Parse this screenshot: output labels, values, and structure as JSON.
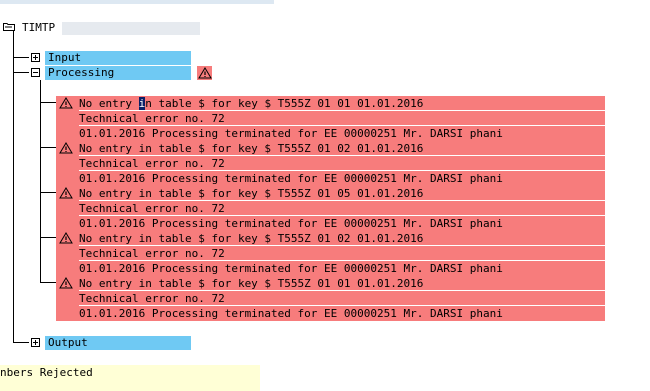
{
  "tree": {
    "root_label": "TIMTP",
    "input_label": "Input",
    "processing_label": "Processing",
    "output_label": "Output"
  },
  "messages": [
    {
      "error": "No entry in table $ for key $ T555Z    01  01 01.01.2016",
      "technical": "Technical error no. 72",
      "terminated": "01.01.2016 Processing terminated for EE 00000251 Mr. DARSI phani"
    },
    {
      "error": "No entry in table $ for key $ T555Z    01  02 01.01.2016",
      "technical": "Technical error no. 72",
      "terminated": "01.01.2016 Processing terminated for EE 00000251 Mr. DARSI phani"
    },
    {
      "error": "No entry in table $ for key $ T555Z    01  05 01.01.2016",
      "technical": "Technical error no. 72",
      "terminated": "01.01.2016 Processing terminated for EE 00000251 Mr. DARSI phani"
    },
    {
      "error": "No entry in table $ for key $ T555Z    01  02 01.01.2016",
      "technical": "Technical error no. 72",
      "terminated": "01.01.2016 Processing terminated for EE 00000251 Mr. DARSI phani"
    },
    {
      "error": "No entry in table $ for key $ T555Z    01  01 01.01.2016",
      "technical": "Technical error no. 72",
      "terminated": "01.01.2016 Processing terminated for EE 00000251 Mr. DARSI phani"
    }
  ],
  "status_bar": {
    "text": "nbers Rejected"
  },
  "colors": {
    "error_bg": "#f77c7c",
    "node_bg": "#6fc9f3",
    "status_bg": "#ffffd6"
  },
  "icons": {
    "folder": "folder-icon",
    "warning": "warning-icon",
    "expand": "plus-icon",
    "collapse": "minus-icon"
  }
}
